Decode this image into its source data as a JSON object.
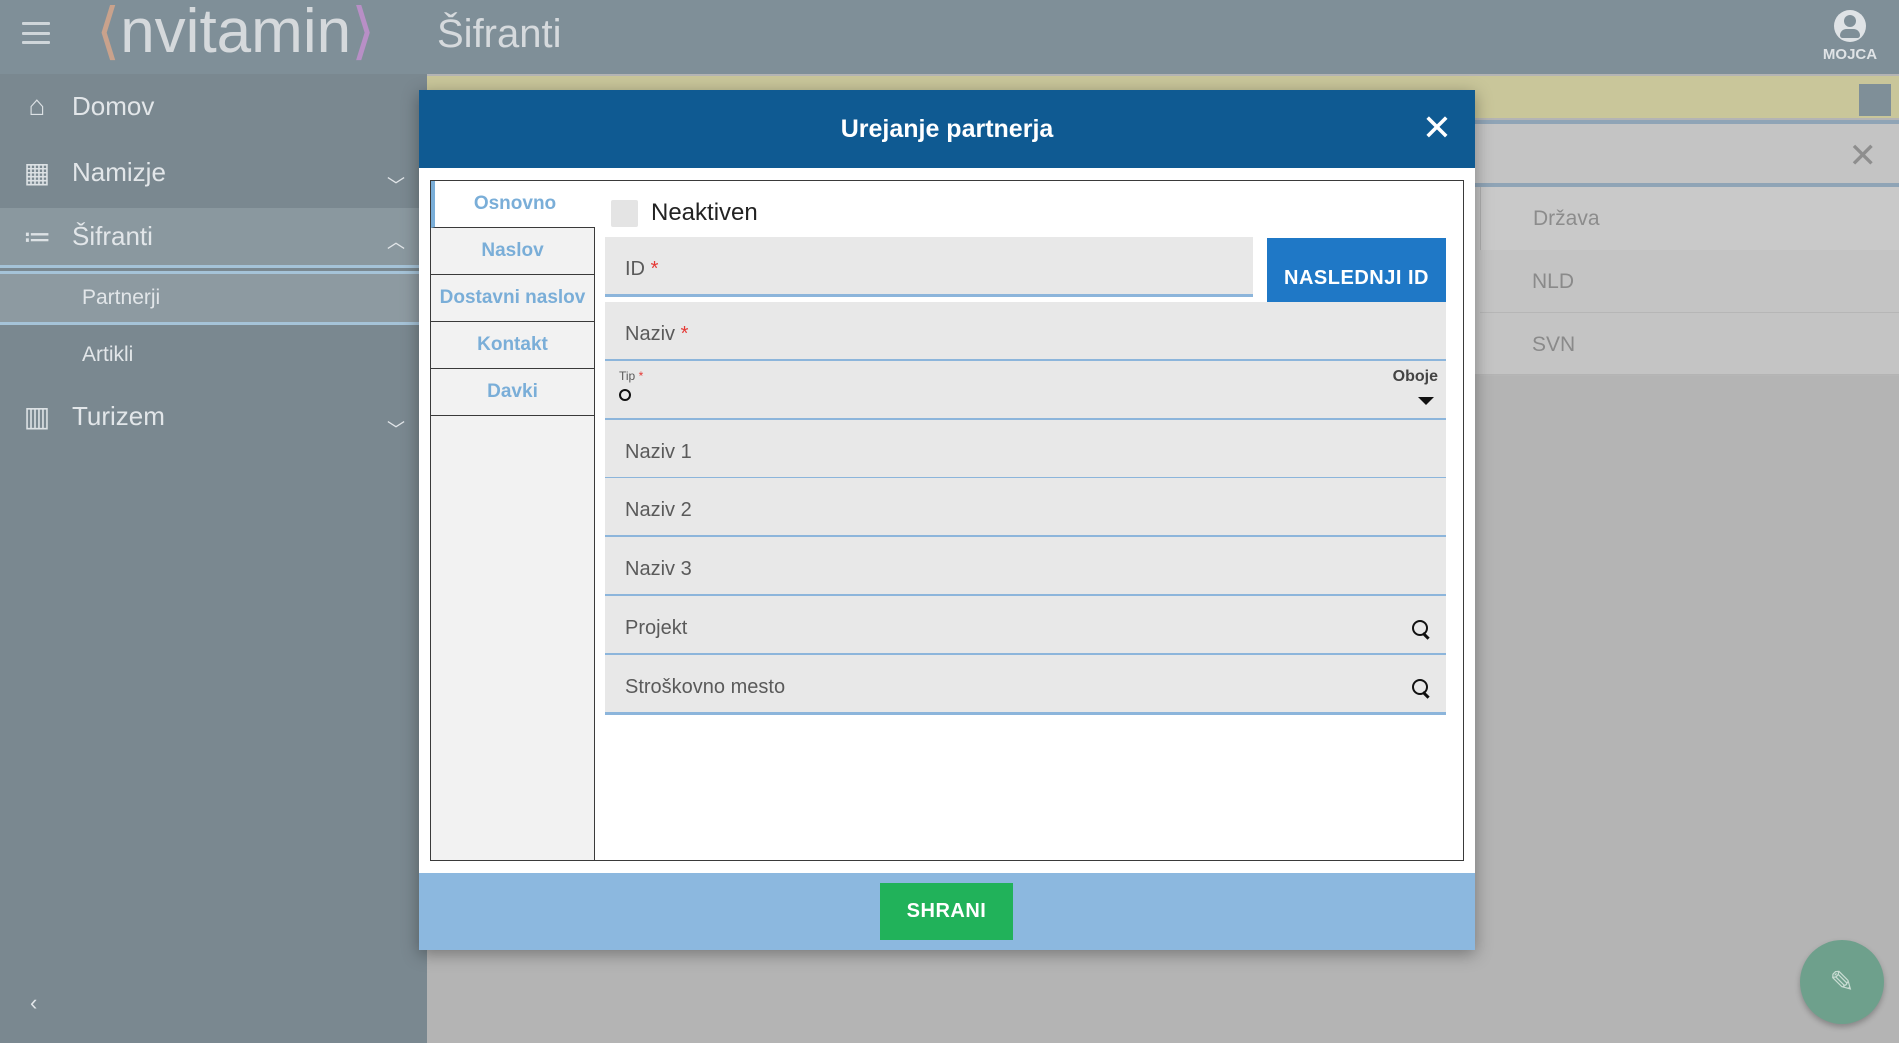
{
  "app": {
    "logo_text": "nvitamin",
    "page_title": "Šifranti",
    "user_name": "MOJCA"
  },
  "sidebar": {
    "items": [
      {
        "label": "Domov",
        "icon": "home-icon"
      },
      {
        "label": "Namizje",
        "icon": "dashboard-icon"
      },
      {
        "label": "Šifranti",
        "icon": "list-icon"
      },
      {
        "label": "Turizem",
        "icon": "luggage-icon"
      }
    ],
    "sub_items": [
      {
        "label": "Partnerji"
      },
      {
        "label": "Artikli"
      }
    ]
  },
  "background": {
    "column_header": "Država",
    "rows": [
      "NLD",
      "SVN"
    ]
  },
  "modal": {
    "title": "Urejanje partnerja",
    "tabs": [
      {
        "label": "Osnovno",
        "active": true
      },
      {
        "label": "Naslov"
      },
      {
        "label": "Dostavni naslov"
      },
      {
        "label": "Kontakt"
      },
      {
        "label": "Davki"
      }
    ],
    "inactive_label": "Neaktiven",
    "next_id_label": "NASLEDNJI ID",
    "fields": {
      "id": {
        "label": "ID",
        "required_mark": "*",
        "value": ""
      },
      "naziv": {
        "label": "Naziv",
        "required_mark": "*",
        "value": ""
      },
      "tip": {
        "label": "Tip",
        "required_mark": "*",
        "value": "Oboje"
      },
      "naziv1": {
        "label": "Naziv 1",
        "value": ""
      },
      "naziv2": {
        "label": "Naziv 2",
        "value": ""
      },
      "naziv3": {
        "label": "Naziv 3",
        "value": ""
      },
      "projekt": {
        "label": "Projekt",
        "value": ""
      },
      "strosek": {
        "label": "Stroškovno mesto",
        "value": ""
      }
    },
    "save_label": "SHRANI"
  },
  "colors": {
    "header_blue": "#0f5a92",
    "accent_blue": "#1f78c6",
    "save_green": "#21b25a",
    "footer_blue": "#8cb8df"
  }
}
